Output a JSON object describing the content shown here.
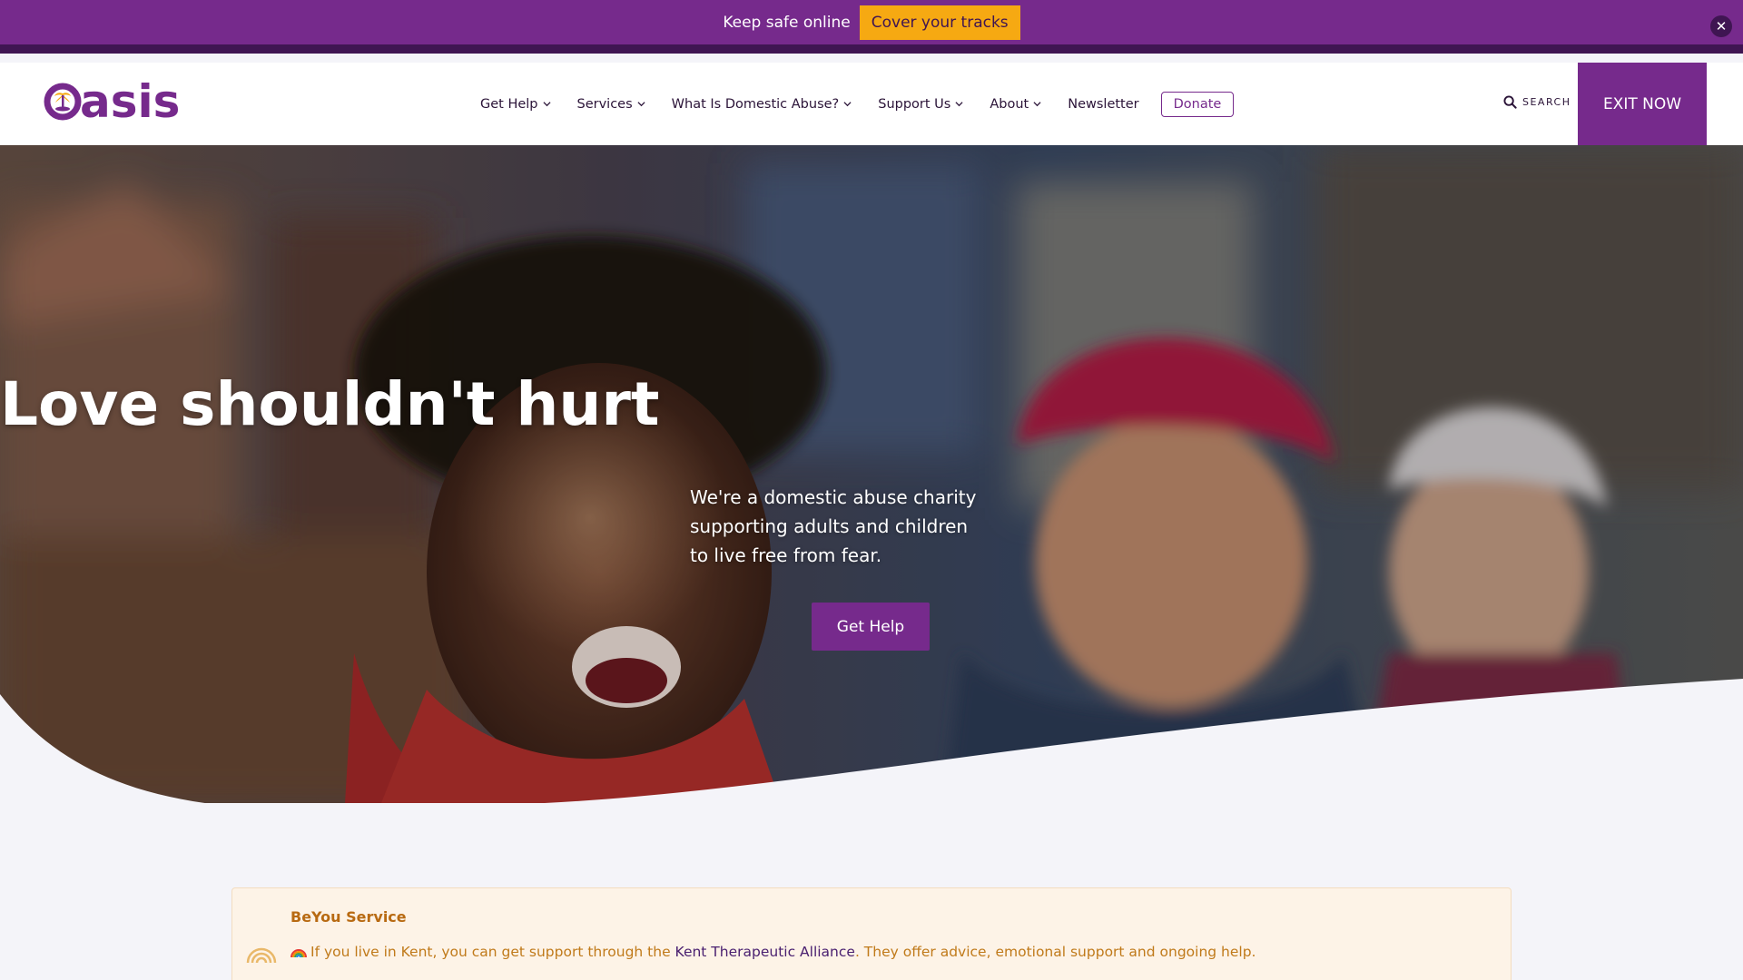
{
  "safety_bar": {
    "text": "Keep safe online",
    "cover_button": "Cover your tracks",
    "close_icon": "close-icon"
  },
  "header": {
    "logo_text": "asis",
    "nav": [
      {
        "label": "Get Help",
        "has_dropdown": true
      },
      {
        "label": "Services",
        "has_dropdown": true
      },
      {
        "label": "What Is Domestic Abuse?",
        "has_dropdown": true
      },
      {
        "label": "Support Us",
        "has_dropdown": true
      },
      {
        "label": "About",
        "has_dropdown": true
      },
      {
        "label": "Newsletter",
        "has_dropdown": false
      }
    ],
    "donate_label": "Donate",
    "search_label": "SEARCH",
    "exit_label": "EXIT NOW"
  },
  "hero": {
    "title": "Love shouldn't hurt",
    "subtitle_line1": "We're a domestic abuse charity",
    "subtitle_line2": "supporting adults and children",
    "subtitle_line3": "to live free from fear.",
    "cta_label": "Get Help"
  },
  "alert": {
    "title": "BeYou Service",
    "body_prefix": "If you live in Kent, you can get support through the ",
    "link_text": "Kent Therapeutic Alliance",
    "body_suffix": ". They offer advice, emotional support and ongoing help."
  },
  "colors": {
    "brand_purple": "#762a8c",
    "dark_purple": "#3f1552",
    "accent_orange": "#f6a912",
    "alert_bg": "#fdf3e7",
    "alert_text": "#c07a1a"
  }
}
